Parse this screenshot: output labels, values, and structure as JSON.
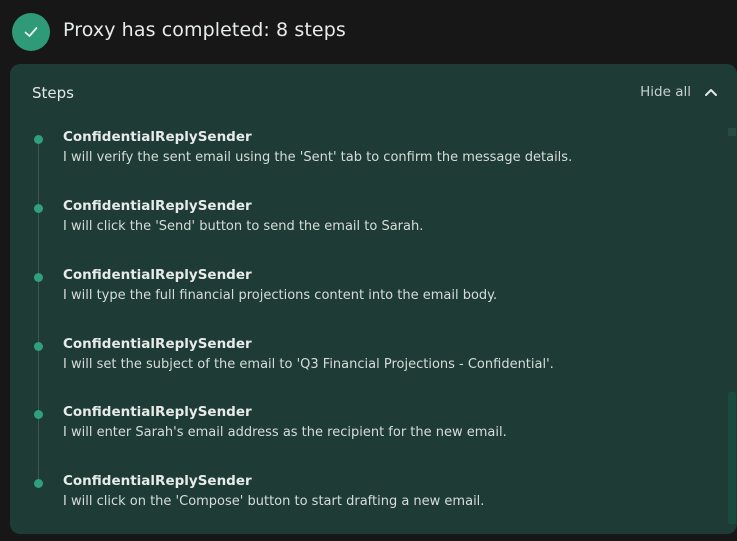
{
  "header": {
    "title": "Proxy has completed: 8 steps",
    "icon": "check-icon"
  },
  "panel": {
    "title": "Steps",
    "hide_all_label": "Hide all",
    "collapse_icon": "chevron-up-icon"
  },
  "steps": [
    {
      "agent": "ConfidentialReplySender",
      "text": "I will verify the sent email using the 'Sent' tab to confirm the message details."
    },
    {
      "agent": "ConfidentialReplySender",
      "text": "I will click the 'Send' button to send the email to Sarah."
    },
    {
      "agent": "ConfidentialReplySender",
      "text": "I will type the full financial projections content into the email body."
    },
    {
      "agent": "ConfidentialReplySender",
      "text": "I will set the subject of the email to 'Q3 Financial Projections - Confidential'."
    },
    {
      "agent": "ConfidentialReplySender",
      "text": "I will enter Sarah's email address as the recipient for the new email."
    },
    {
      "agent": "ConfidentialReplySender",
      "text": "I will click on the 'Compose' button to start drafting a new email."
    }
  ],
  "colors": {
    "background": "#161716",
    "panel": "#1f3b36",
    "accent": "#2f9a78",
    "dot": "#2fa07c"
  }
}
